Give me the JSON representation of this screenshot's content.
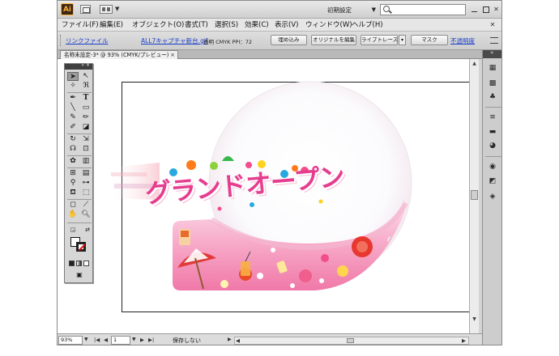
{
  "app": {
    "logo": "Ai",
    "workspace_switcher": "初期設定",
    "search_placeholder": ""
  },
  "menu": {
    "items": [
      "ファイル(F)",
      "編集(E)",
      "オブジェクト(O)",
      "書式(T)",
      "選択(S)",
      "効果(C)",
      "表示(V)",
      "ウィンドウ(W)",
      "ヘルプ(H)"
    ]
  },
  "control_bar": {
    "linked_file": "リンクファイル",
    "file_name": "ALL7キャプチャ新台.gif",
    "info": "透明  CMYK    PPI：72",
    "embed_button": "埋め込み",
    "edit_original_button": "オリジナルを編集",
    "live_trace_button": "ライブトレース",
    "mask_button": "マスク",
    "opacity_link": "不透明度"
  },
  "document": {
    "tab_title": "名称未設定-3* @ 93% (CMYK/プレビュー)",
    "tab_close": "×"
  },
  "artwork": {
    "title_text": "グランドオープン"
  },
  "status_bar": {
    "zoom": "93%",
    "page": "1",
    "status_text": "保存しない"
  },
  "icons": {
    "tools": [
      "selection-tool",
      "direct-selection-tool",
      "magic-wand-tool",
      "lasso-tool",
      "pen-tool",
      "type-tool",
      "line-tool",
      "rectangle-tool",
      "paintbrush-tool",
      "pencil-tool",
      "blob-brush-tool",
      "eraser-tool",
      "rotate-tool",
      "scale-tool",
      "warp-tool",
      "free-transform-tool",
      "symbol-sprayer-tool",
      "column-graph-tool",
      "mesh-tool",
      "gradient-tool",
      "eyedropper-tool",
      "blend-tool",
      "live-paint-bucket-tool",
      "live-paint-selection-tool",
      "artboard-tool",
      "slice-tool",
      "hand-tool",
      "zoom-tool"
    ],
    "dock": [
      "color-guide-icon",
      "swatches-icon",
      "symbols-icon",
      "stroke-icon",
      "gradient-icon",
      "transparency-icon",
      "appearance-icon",
      "graphic-styles-icon",
      "layers-icon"
    ]
  }
}
